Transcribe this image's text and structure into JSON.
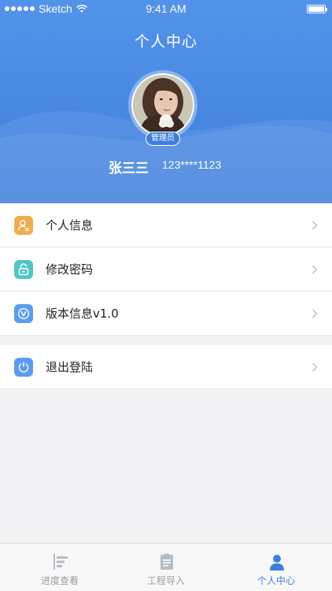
{
  "status_bar": {
    "carrier": "Sketch",
    "time": "9:41 AM"
  },
  "header": {
    "title": "个人中心"
  },
  "profile": {
    "role_badge": "管理员",
    "name": "张三三",
    "phone": "123****1123",
    "avatar": "user-photo"
  },
  "menu": {
    "items": [
      {
        "label": "个人信息",
        "icon": "person-info-icon",
        "color": "#f0ad4e"
      },
      {
        "label": "修改密码",
        "icon": "lock-icon",
        "color": "#4fc6c6"
      },
      {
        "label": "版本信息v1.0",
        "icon": "version-icon",
        "color": "#5b9bf0"
      }
    ],
    "logout": {
      "label": "退出登陆",
      "icon": "power-icon",
      "color": "#5b9bf0"
    }
  },
  "tabbar": {
    "tabs": [
      {
        "label": "进度查看",
        "icon": "progress-icon",
        "active": false
      },
      {
        "label": "工程导入",
        "icon": "document-icon",
        "active": false
      },
      {
        "label": "个人中心",
        "icon": "person-icon",
        "active": true
      }
    ]
  },
  "colors": {
    "accent": "#3f7fdc",
    "header_top": "#5393ea"
  }
}
